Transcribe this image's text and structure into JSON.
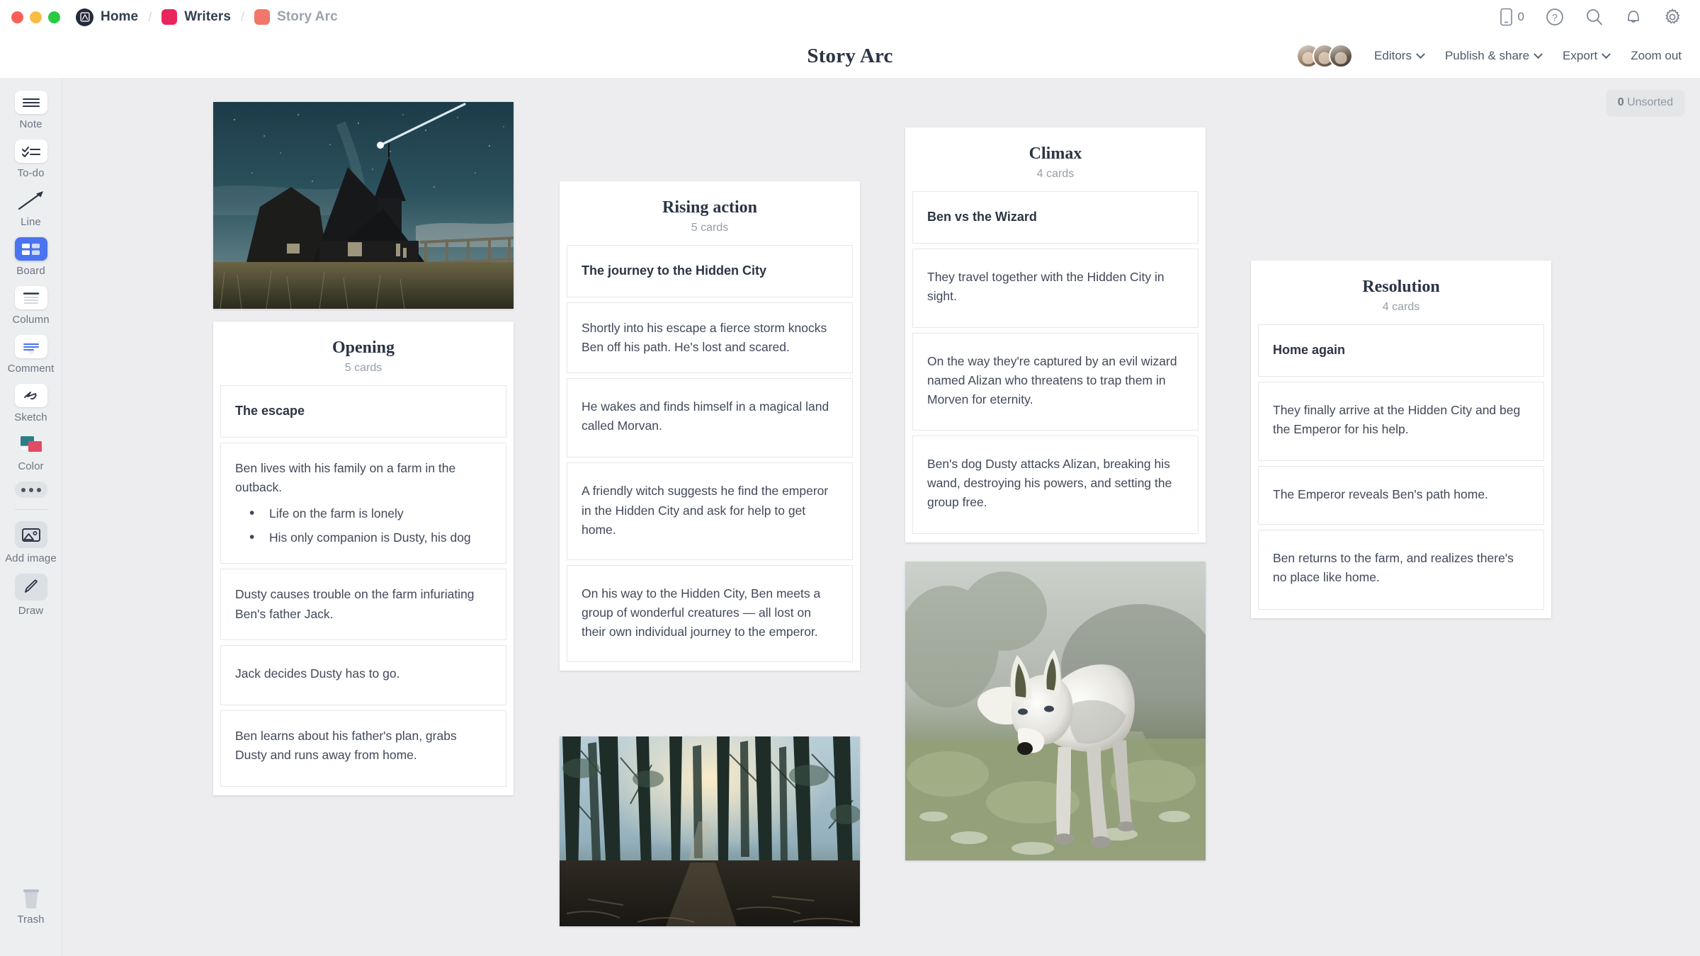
{
  "window": {
    "traffic_lights": [
      "close",
      "minimize",
      "zoom"
    ]
  },
  "breadcrumb": {
    "home": {
      "label": "Home",
      "icon": "milanote-logo-icon"
    },
    "separator": "/",
    "items": [
      {
        "label": "Writers",
        "color": "#e8255c",
        "icon": "board-swatch-icon"
      },
      {
        "label": "Story Arc",
        "color": "#f2766a",
        "icon": "board-swatch-icon",
        "current": true
      }
    ]
  },
  "topbar_right": {
    "phone_icon": "mobile-icon",
    "phone_count": "0",
    "help_icon": "help-circle-icon",
    "search_icon": "search-icon",
    "notifications_icon": "bell-icon",
    "settings_icon": "gear-icon"
  },
  "header": {
    "title": "Story Arc",
    "editors_label": "Editors",
    "publish_label": "Publish & share",
    "export_label": "Export",
    "zoom_out_label": "Zoom out",
    "avatar_count": 3
  },
  "toolbar": {
    "items": [
      {
        "label": "Note",
        "icon": "note-icon",
        "active": false
      },
      {
        "label": "To-do",
        "icon": "todo-icon",
        "active": false
      },
      {
        "label": "Line",
        "icon": "line-arrow-icon",
        "active": false
      },
      {
        "label": "Board",
        "icon": "board-icon",
        "active": true
      },
      {
        "label": "Column",
        "icon": "column-icon",
        "active": false
      },
      {
        "label": "Comment",
        "icon": "comment-icon",
        "active": false
      },
      {
        "label": "Sketch",
        "icon": "sketch-icon",
        "active": false
      },
      {
        "label": "Color",
        "icon": "color-swatches-icon",
        "active": false
      }
    ],
    "more_icon": "more-dots-icon",
    "add_image": {
      "label": "Add image",
      "icon": "add-image-icon"
    },
    "draw": {
      "label": "Draw",
      "icon": "pencil-icon"
    },
    "trash": {
      "label": "Trash",
      "icon": "trash-icon"
    }
  },
  "canvas": {
    "unsorted_count": "0",
    "unsorted_label": "Unsorted",
    "images": [
      {
        "name": "night-church-photo",
        "alt": "Dark church at night under starry sky with comet"
      },
      {
        "name": "forest-photo",
        "alt": "Sunlit misty forest with tall trees"
      },
      {
        "name": "white-wolf-photo",
        "alt": "White wolf dog walking in a misty meadow"
      }
    ],
    "columns": [
      {
        "title": "Opening",
        "count": "5 cards",
        "cards": [
          {
            "type": "title",
            "text": "The escape"
          },
          {
            "type": "body",
            "text": "Ben lives with his family on a farm in the outback.",
            "bullets": [
              "Life on the farm is lonely",
              "His only companion is Dusty, his dog"
            ]
          },
          {
            "type": "body",
            "text": "Dusty causes trouble on the farm infuriating Ben's father Jack."
          },
          {
            "type": "body",
            "text": "Jack decides Dusty has to go."
          },
          {
            "type": "body",
            "text": "Ben learns about his father's plan, grabs Dusty and runs away from home."
          }
        ]
      },
      {
        "title": "Rising action",
        "count": "5 cards",
        "cards": [
          {
            "type": "title",
            "text": "The journey to the Hidden City"
          },
          {
            "type": "body",
            "text": "Shortly into his escape a fierce storm knocks Ben off his path. He's lost and scared."
          },
          {
            "type": "body",
            "text": "He wakes and finds himself in a magical land called Morvan."
          },
          {
            "type": "body",
            "text": "A friendly witch suggests he find the emperor in the Hidden City and ask for help to get home."
          },
          {
            "type": "body",
            "text": "On his way to the Hidden City, Ben meets a group of wonderful creatures — all lost on their own individual journey to the emperor."
          }
        ]
      },
      {
        "title": "Climax",
        "count": "4 cards",
        "cards": [
          {
            "type": "title",
            "text": "Ben vs the Wizard"
          },
          {
            "type": "body",
            "text": "They travel together with the Hidden City in sight."
          },
          {
            "type": "body",
            "text": "On the way they're captured by an evil wizard named Alizan who threatens to trap them in Morven for eternity."
          },
          {
            "type": "body",
            "text": "Ben's dog Dusty attacks Alizan, breaking his wand, destroying his powers, and setting the group free."
          }
        ]
      },
      {
        "title": "Resolution",
        "count": "4 cards",
        "cards": [
          {
            "type": "title",
            "text": "Home again"
          },
          {
            "type": "body",
            "text": "They finally arrive at the Hidden City and beg the Emperor for his help."
          },
          {
            "type": "body",
            "text": "The Emperor reveals Ben's path home."
          },
          {
            "type": "body",
            "text": "Ben returns to the farm, and realizes there's no place like home."
          }
        ]
      }
    ],
    "connectors": [
      {
        "name": "arrow-opening-to-rising"
      },
      {
        "name": "arrow-rising-to-climax"
      },
      {
        "name": "arrow-climax-to-resolution"
      }
    ]
  },
  "colors": {
    "canvas_bg": "#ededef",
    "toolbar_bg": "#eceef0",
    "accent_blue": "#4a73f0",
    "text_dark": "#2b3444",
    "text_body": "#41495a",
    "text_muted": "#959da7"
  }
}
